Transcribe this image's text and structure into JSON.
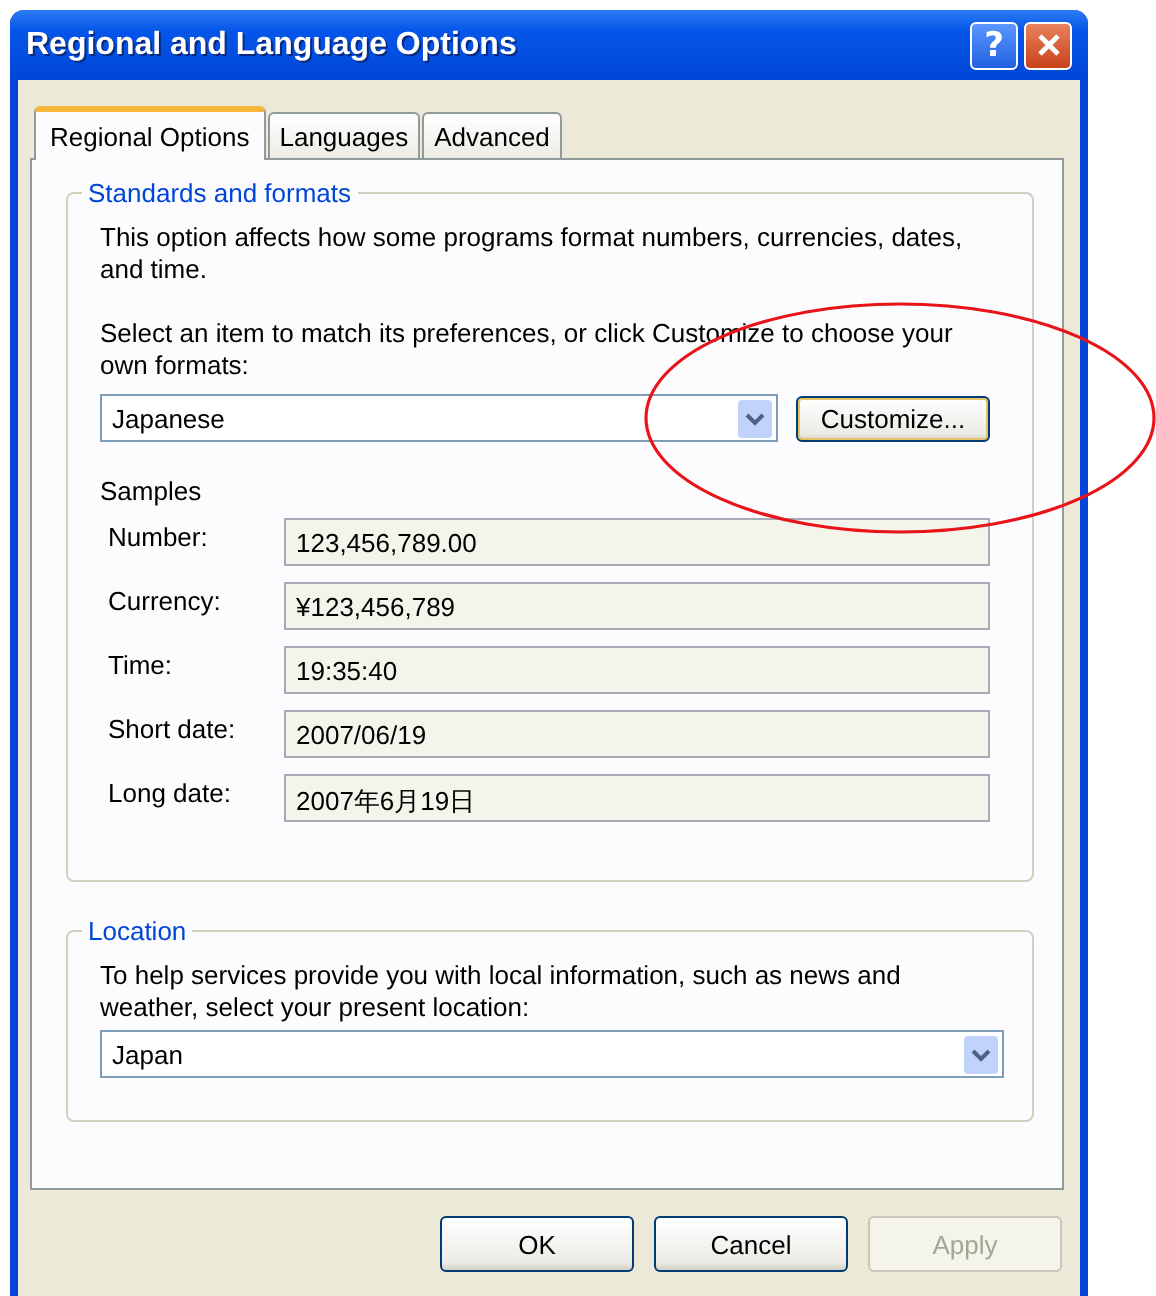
{
  "window": {
    "title": "Regional and Language Options"
  },
  "title_buttons": [
    {
      "kind": "help",
      "label": "?"
    },
    {
      "kind": "close"
    }
  ],
  "tabs": [
    {
      "label": "Regional Options",
      "selected": true
    },
    {
      "label": "Languages",
      "selected": false
    },
    {
      "label": "Advanced",
      "selected": false
    }
  ],
  "standards": {
    "legend": "Standards and formats",
    "description": "This option affects how some programs format numbers, currencies, dates, and time.",
    "prompt": "Select an item to match its preferences, or click Customize to choose your own formats:",
    "format_select": {
      "value": "Japanese"
    },
    "customize_button": "Customize...",
    "samples_label": "Samples",
    "samples": [
      {
        "label": "Number:",
        "value": "123,456,789.00"
      },
      {
        "label": "Currency:",
        "value": "¥123,456,789"
      },
      {
        "label": "Time:",
        "value": "19:35:40"
      },
      {
        "label": "Short date:",
        "value": "2007/06/19"
      },
      {
        "label": "Long date:",
        "value": "2007年6月19日"
      }
    ]
  },
  "location": {
    "legend": "Location",
    "description": "To help services provide you with local information, such as news and weather, select your present location:",
    "select": {
      "value": "Japan"
    }
  },
  "buttons": [
    {
      "label": "OK",
      "disabled": false
    },
    {
      "label": "Cancel",
      "disabled": false
    },
    {
      "label": "Apply",
      "disabled": true
    }
  ],
  "annotations": [
    {
      "kind": "ellipse"
    }
  ]
}
